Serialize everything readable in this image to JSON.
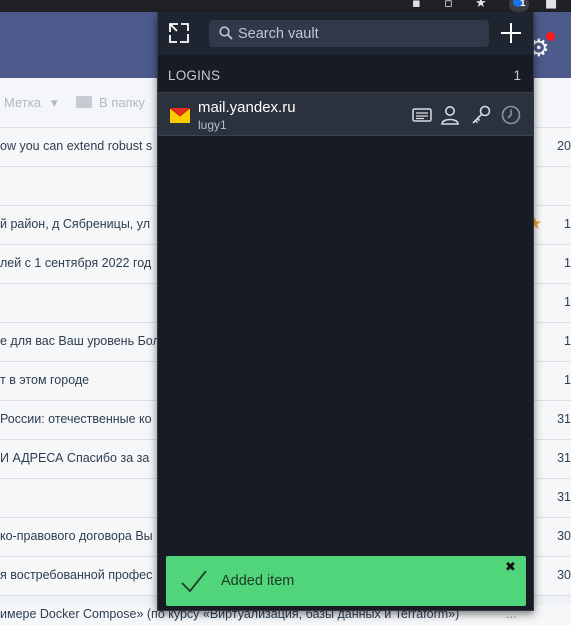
{
  "background_mail": {
    "toolbar": {
      "label_button": "Метка",
      "folder_button": "В папку"
    },
    "rows": [
      {
        "subject": "ow you can extend robust s",
        "date": "20",
        "starred": false
      },
      {
        "subject": "",
        "date": "",
        "starred": false
      },
      {
        "subject": "й район, д Сябреницы, ул",
        "date": "1",
        "starred": true
      },
      {
        "subject": "лей с 1 сентября 2022 год",
        "date": "1",
        "starred": false
      },
      {
        "subject": "",
        "date": "1",
        "starred": false
      },
      {
        "subject": "е для вас Ваш уровень Бол",
        "date": "1",
        "starred": false
      },
      {
        "subject": "т в этом городе",
        "date": "1",
        "starred": false
      },
      {
        "subject": "России: отечественные ко",
        "date": "31",
        "starred": false
      },
      {
        "subject": "И АДРЕСА Спасибо за за",
        "date": "31",
        "starred": false
      },
      {
        "subject": "",
        "date": "31",
        "starred": false
      },
      {
        "subject": "ко-правового договора Вы",
        "date": "30",
        "starred": false
      },
      {
        "subject": "я востребованной профес",
        "date": "30",
        "starred": false
      }
    ],
    "bottom_row": {
      "subject": "имере Docker Compose» (по курсу «Виртуализация, базы данных и Terraform»)",
      "date": "..."
    }
  },
  "vault": {
    "search": {
      "placeholder": "Search vault"
    },
    "section": {
      "title": "LOGINS",
      "count": "1"
    },
    "items": [
      {
        "title": "mail.yandex.ru",
        "subtitle": "lugy1",
        "favicon": "yandex-mail-envelope-icon",
        "actions": [
          "view-notes-icon",
          "copy-username-icon",
          "copy-password-icon",
          "launch-history-icon"
        ]
      }
    ]
  },
  "toast": {
    "message": "Added item",
    "close_glyph": "✖"
  },
  "colors": {
    "vault_background": "#161b24",
    "vault_header": "#1f2530",
    "toast_background": "#51d57a",
    "mail_header": "#4d5a8c"
  }
}
